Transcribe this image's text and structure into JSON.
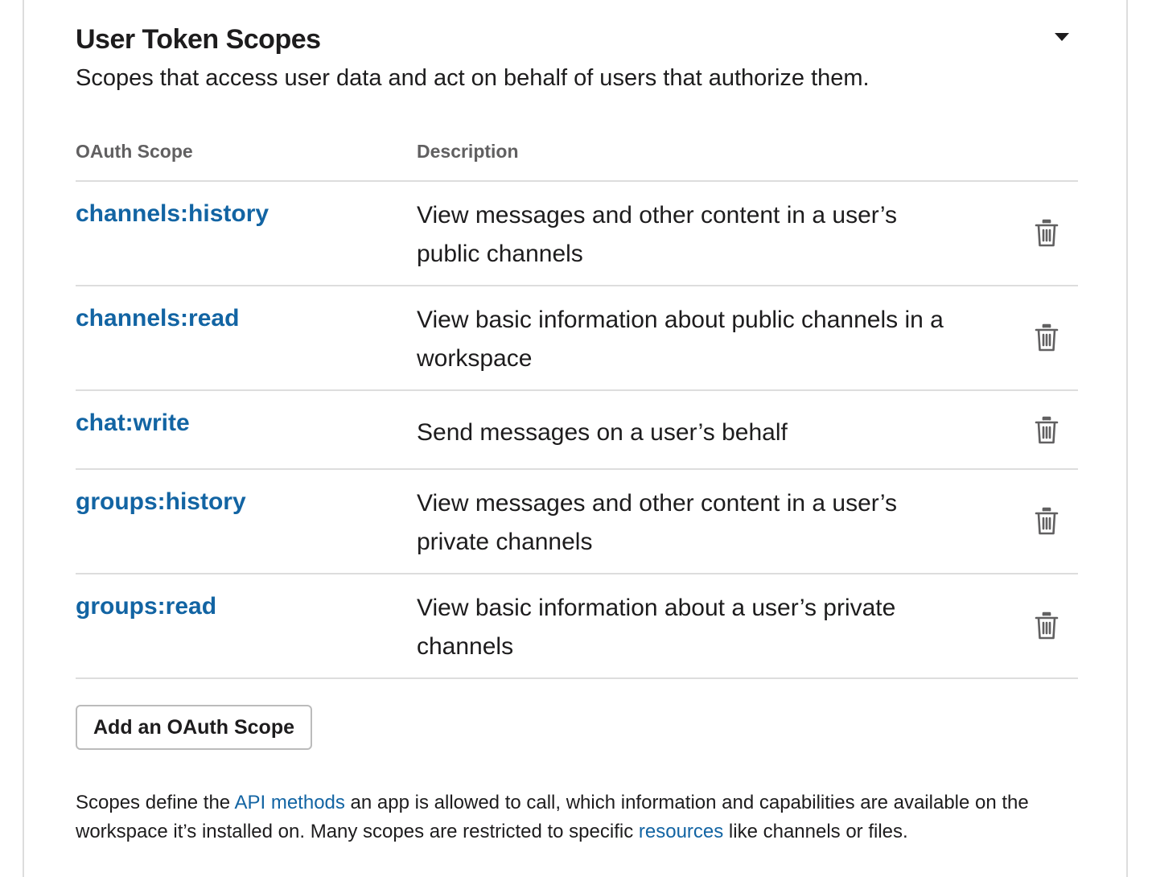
{
  "section": {
    "title": "User Token Scopes",
    "subtitle": "Scopes that access user data and act on behalf of users that authorize them.",
    "collapse_icon": "caret-down-icon"
  },
  "table": {
    "headers": {
      "scope": "OAuth Scope",
      "description": "Description"
    },
    "rows": [
      {
        "scope": "channels:history",
        "description": "View messages and other content in a user’s public channels",
        "action_icon": "trash-icon"
      },
      {
        "scope": "channels:read",
        "description": "View basic information about public channels in a workspace",
        "action_icon": "trash-icon"
      },
      {
        "scope": "chat:write",
        "description": "Send messages on a user’s behalf",
        "action_icon": "trash-icon"
      },
      {
        "scope": "groups:history",
        "description": "View messages and other content in a user’s private channels",
        "action_icon": "trash-icon"
      },
      {
        "scope": "groups:read",
        "description": "View basic information about a user’s private channels",
        "action_icon": "trash-icon"
      }
    ]
  },
  "add_button": {
    "label": "Add an OAuth Scope"
  },
  "footnote": {
    "part1": "Scopes define the ",
    "link1": "API methods",
    "part2": " an app is allowed to call, which information and capabilities are available on the workspace it’s installed on. Many scopes are restricted to specific ",
    "link2": "resources",
    "part3": " like channels or files."
  },
  "colors": {
    "link": "#1264a3",
    "text": "#1d1c1d",
    "muted": "#616061",
    "divider": "#dddddd"
  }
}
